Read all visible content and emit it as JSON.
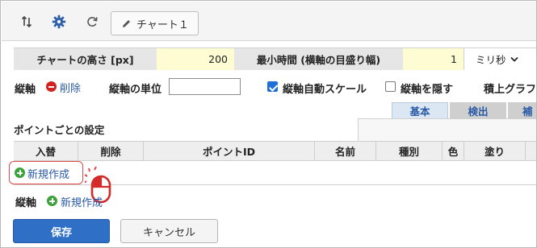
{
  "toolbar": {
    "sort_icon": "sort-arrows-icon",
    "settings_icon": "gear-icon",
    "refresh_icon": "refresh-icon",
    "chart_tab_label": "チャート１",
    "chart_tab_icon": "pencil-icon"
  },
  "settings": {
    "height_label": "チャートの高さ [px]",
    "height_value": "200",
    "min_time_label": "最小時間 (横軸の目盛り幅)",
    "min_time_value": "1",
    "unit_select": "ミリ秒"
  },
  "axis": {
    "label": "縦軸",
    "delete_label": "削除",
    "unit_label": "縦軸の単位",
    "unit_value": "",
    "auto_scale_label": "縦軸自動スケール",
    "auto_scale_checked": true,
    "hide_label": "縦軸を隠す",
    "hide_checked": false,
    "stack_label": "積上グラフ"
  },
  "subtabs": [
    "基本",
    "検出",
    "補"
  ],
  "points": {
    "title": "ポイントごとの設定",
    "columns": [
      "入替",
      "削除",
      "ポイントID",
      "名前",
      "種別",
      "色",
      "塗り"
    ],
    "new_label": "新規作成"
  },
  "axis_new": {
    "label": "縦軸",
    "new_label": "新規作成"
  },
  "footer": {
    "save_label": "保存",
    "cancel_label": "キャンセル"
  },
  "colors": {
    "accent": "#2f6fc6",
    "link": "#2a5aa5",
    "highlight": "#e04a4a",
    "value_bg": "#fdfcd2"
  }
}
